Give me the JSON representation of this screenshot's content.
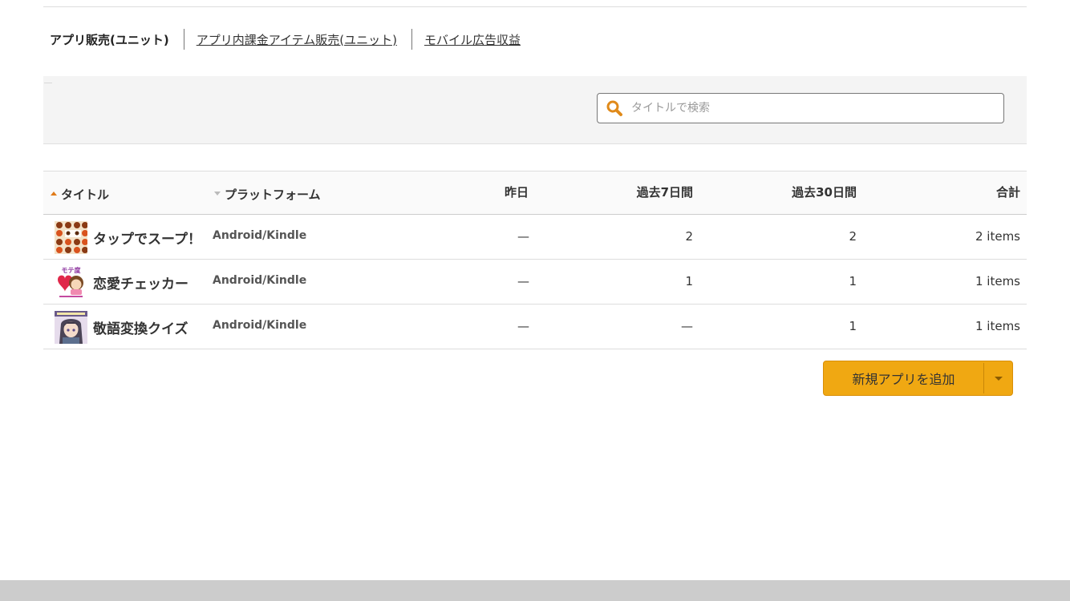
{
  "tabs": {
    "active": "アプリ販売(ユニット)",
    "in_app": "アプリ内課金アイテム販売(ユニット)",
    "ads": "モバイル広告収益"
  },
  "search": {
    "placeholder": "タイトルで検索",
    "value": ""
  },
  "table": {
    "headers": {
      "title": "タイトル",
      "platform": "プラットフォーム",
      "yesterday": "昨日",
      "last7": "過去7日間",
      "last30": "過去30日間",
      "total": "合計"
    },
    "rows": [
      {
        "title": "タップでスープ！",
        "thumb_icon": "soup-app-thumbnail-icon",
        "platform": "Android/Kindle",
        "yesterday": "—",
        "last7": "2",
        "last30": "2",
        "total": "2 items"
      },
      {
        "title": "恋愛チェッカー",
        "thumb_icon": "love-checker-app-thumbnail-icon",
        "thumb_text": "モテ度",
        "platform": "Android/Kindle",
        "yesterday": "—",
        "last7": "1",
        "last30": "1",
        "total": "1 items"
      },
      {
        "title": "敬語変換クイズ",
        "thumb_icon": "keigo-quiz-app-thumbnail-icon",
        "platform": "Android/Kindle",
        "yesterday": "—",
        "last7": "—",
        "last30": "1",
        "total": "1 items"
      }
    ]
  },
  "add_app": {
    "label": "新規アプリを追加"
  },
  "colors": {
    "accent_orange": "#f0a812",
    "sort_arrow": "#e07b1a",
    "search_icon": "#e08a1a"
  }
}
